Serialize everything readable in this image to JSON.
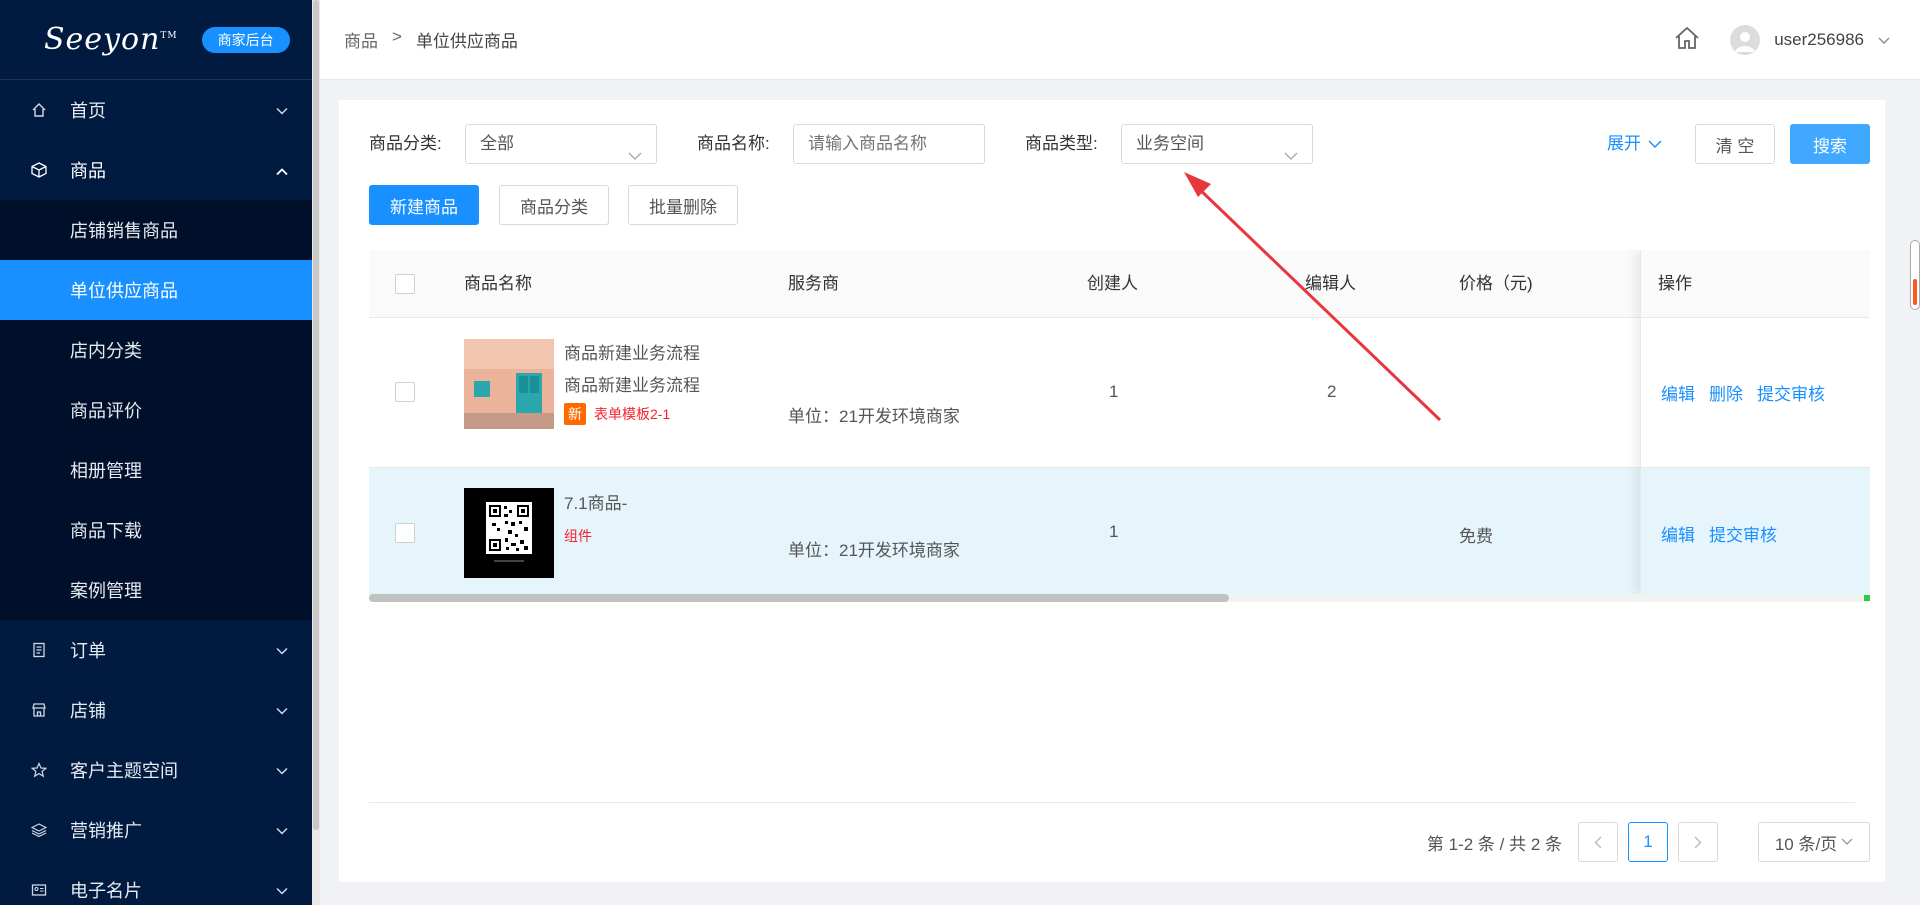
{
  "sidebar": {
    "logo": "Seeyon",
    "logo_tm": "TM",
    "badge": "商家后台",
    "menu": [
      {
        "label": "首页",
        "icon": "home-icon"
      },
      {
        "label": "商品",
        "icon": "box-icon"
      },
      {
        "label": "订单",
        "icon": "order-icon"
      },
      {
        "label": "店铺",
        "icon": "store-icon"
      },
      {
        "label": "客户主题空间",
        "icon": "star-icon"
      },
      {
        "label": "营销推广",
        "icon": "layers-icon"
      },
      {
        "label": "电子名片",
        "icon": "card-icon"
      }
    ],
    "submenu": [
      "店铺销售商品",
      "单位供应商品",
      "店内分类",
      "商品评价",
      "相册管理",
      "商品下载",
      "案例管理"
    ]
  },
  "header": {
    "breadcrumb_root": "商品",
    "breadcrumb_sep": ">",
    "breadcrumb_current": "单位供应商品",
    "username": "user256986"
  },
  "filters": {
    "category_label": "商品分类:",
    "category_value": "全部",
    "name_label": "商品名称:",
    "name_placeholder": "请输入商品名称",
    "type_label": "商品类型:",
    "type_value": "业务空间",
    "expand": "展开",
    "clear": "清 空",
    "search": "搜索"
  },
  "actions": {
    "new": "新建商品",
    "category": "商品分类",
    "batch_delete": "批量删除"
  },
  "table": {
    "columns": [
      "商品名称",
      "服务商",
      "创建人",
      "编辑人",
      "价格（元)",
      "操作"
    ],
    "rows": [
      {
        "name_line1": "商品新建业务流程",
        "name_line2": "商品新建业务流程",
        "tag_badge": "新",
        "tag_text": "表单模板2-1",
        "provider": "单位：21开发环境商家",
        "creator": "1",
        "editor": "2",
        "price": "",
        "ops": [
          "编辑",
          "删除",
          "提交审核"
        ]
      },
      {
        "name_line1": "7.1商品-",
        "tag_text": "组件",
        "provider": "单位：21开发环境商家",
        "creator": "1",
        "editor": "",
        "price": "免费",
        "ops": [
          "编辑",
          "提交审核"
        ]
      }
    ]
  },
  "pagination": {
    "total": "第 1-2 条 / 共 2 条",
    "current": "1",
    "page_size": "10 条/页"
  },
  "colors": {
    "sidebar_bg": "#001a40",
    "primary": "#1890ff",
    "annotation_arrow": "#e8363d"
  }
}
